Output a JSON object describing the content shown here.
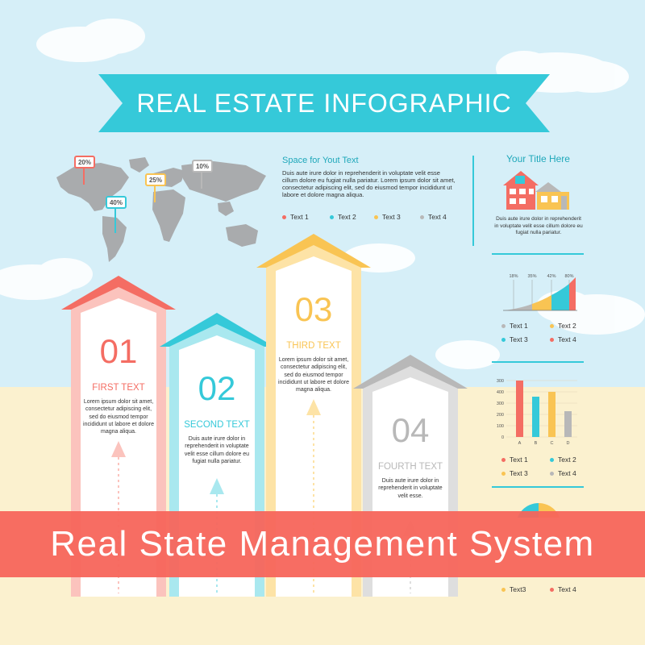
{
  "banner_title": "REAL ESTATE INFOGRAPHIC",
  "map": {
    "markers": [
      {
        "label": "20%",
        "color": "#f46d63"
      },
      {
        "label": "40%",
        "color": "#35c9d9"
      },
      {
        "label": "25%",
        "color": "#f9c453"
      },
      {
        "label": "10%",
        "color": "#b8b8b8"
      }
    ]
  },
  "space_section": {
    "heading": "Space for Yout Text",
    "body": "Duis aute irure dolor in reprehenderit in voluptate velit esse cillum dolore eu fugiat nulla pariatur. Lorem ipsum dolor sit amet, consectetur adipiscing elit, sed do eiusmod tempor incididunt ut labore et dolore magna aliqua.",
    "legend": [
      "Text 1",
      "Text 2",
      "Text 3",
      "Text 4"
    ]
  },
  "legend_colors": [
    "#f46d63",
    "#35c9d9",
    "#f9c453",
    "#b8b8b8"
  ],
  "right_panel": {
    "title": "Your Title Here",
    "body": "Duis aute irure dolor in reprehenderit in voluptate velit esse cillum dolore eu fugiat nulla pariatur.",
    "area_chart": {
      "percent_labels": [
        "18%",
        "35%",
        "42%",
        "80%"
      ],
      "legend": [
        "Text 1",
        "Text 2",
        "Text 3",
        "Text 4"
      ]
    },
    "bar_chart": {
      "y_ticks": [
        "300",
        "400",
        "300",
        "200",
        "100",
        "0"
      ],
      "categories": [
        "A",
        "B",
        "C",
        "D"
      ],
      "legend": [
        "Text 1",
        "Text 2",
        "Text 3",
        "Text 4"
      ]
    },
    "bottom_legend": [
      "Text3",
      "Text 4"
    ]
  },
  "cards": [
    {
      "number": "01",
      "title": "FIRST TEXT",
      "body": "Lorem ipsum dolor sit amet, consectetur adipiscing elit, sed do eiusmod tempor incididunt ut labore et dolore magna aliqua.",
      "color": "#f46d63",
      "light": "#fbc3bd"
    },
    {
      "number": "02",
      "title": "SECOND TEXT",
      "body": "Duis aute irure dolor in reprehenderit in voluptate velit esse cillum dolore eu fugiat nulla pariatur.",
      "color": "#35c9d9",
      "light": "#a9e8ef"
    },
    {
      "number": "03",
      "title": "THIRD TEXT",
      "body": "Lorem ipsum dolor sit amet, consectetur adipiscing elit, sed do eiusmod tempor incididunt ut labore et dolore magna aliqua.",
      "color": "#f9c453",
      "light": "#fde3a6"
    },
    {
      "number": "04",
      "title": "FOURTH TEXT",
      "body": "Duis aute irure dolor in reprehenderit in voluptate velit esse.",
      "color": "#b8b8b8",
      "light": "#dedede"
    }
  ],
  "overlay_caption": "Real State Management System"
}
